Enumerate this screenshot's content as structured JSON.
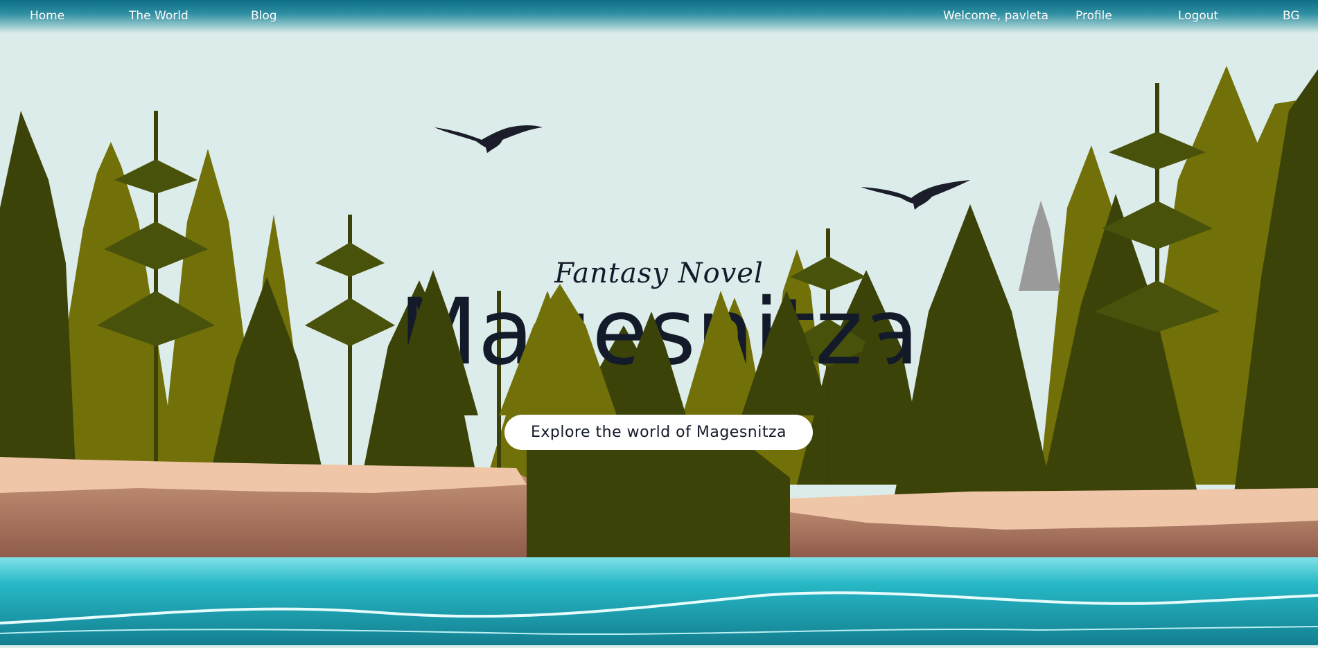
{
  "nav": {
    "home": "Home",
    "world": "The World",
    "blog": "Blog",
    "welcome": "Welcome, pavleta",
    "profile": "Profile",
    "logout": "Logout",
    "lang": "BG"
  },
  "hero": {
    "subtitle": "Fantasy Novel",
    "title": "Magesnitza",
    "cta": "Explore the world of Magesnitza"
  },
  "icons": [
    "eagle-icon",
    "tree-icon"
  ],
  "colors": {
    "nav_top": "#0e6f86",
    "sky": "#dcecea",
    "olive": "#6e6c07",
    "dark_tree": "#3b4108",
    "cliff_top": "#efc6a8",
    "cliff_face": "#b57f67",
    "water": "#1fb0c0",
    "text_dark": "#131a2a"
  }
}
